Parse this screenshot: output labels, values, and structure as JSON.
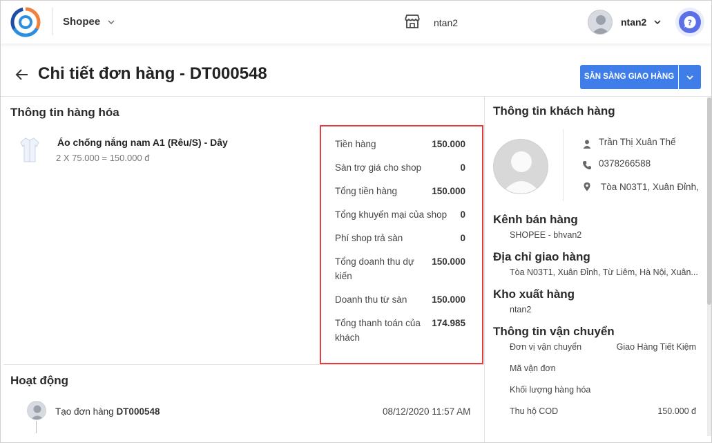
{
  "topbar": {
    "channel": "Shopee",
    "store_name": "ntan2",
    "user_name": "ntan2"
  },
  "header": {
    "title": "Chi tiết đơn hàng - DT000548",
    "ready_button": "SẴN SÀNG GIAO HÀNG"
  },
  "goods": {
    "title": "Thông tin hàng hóa",
    "product_name": "Áo chống nắng nam A1 (Rêu/S) - Dây",
    "product_qty_line": "2 X 75.000 = 150.000 đ"
  },
  "summary": {
    "rows": [
      {
        "label": "Tiền hàng",
        "value": "150.000"
      },
      {
        "label": "Sàn trợ giá cho shop",
        "value": "0"
      },
      {
        "label": "Tổng tiền hàng",
        "value": "150.000"
      },
      {
        "label": "Tổng khuyến mại của shop",
        "value": "0"
      },
      {
        "label": "Phí shop trả sàn",
        "value": "0"
      },
      {
        "label": "Tổng doanh thu dự kiến",
        "value": "150.000"
      },
      {
        "label": "Doanh thu từ sàn",
        "value": "150.000"
      },
      {
        "label": "Tổng thanh toán của khách",
        "value": "174.985"
      }
    ]
  },
  "activity": {
    "title": "Hoạt động",
    "items": [
      {
        "text": "Tạo đơn hàng",
        "code": "DT000548",
        "time": "08/12/2020 11:57 AM"
      }
    ]
  },
  "customer": {
    "title": "Thông tin khách hàng",
    "name": "Trần Thị Xuân Thế",
    "phone": "0378266588",
    "address": "Tòa N03T1, Xuân Đỉnh,"
  },
  "sales_channel": {
    "title": "Kênh bán hàng",
    "value": "SHOPEE - bhvan2"
  },
  "delivery_address": {
    "title": "Địa chỉ giao hàng",
    "value": "Tòa N03T1, Xuân Đỉnh, Từ Liêm, Hà Nội, Xuân..."
  },
  "warehouse": {
    "title": "Kho xuất hàng",
    "value": "ntan2"
  },
  "shipping": {
    "title": "Thông tin vận chuyển",
    "rows": [
      {
        "label": "Đơn vị vận chuyển",
        "value": "Giao Hàng Tiết Kiệm"
      },
      {
        "label": "Mã vận đơn",
        "value": ""
      },
      {
        "label": "Khối lượng hàng hóa",
        "value": ""
      },
      {
        "label": "Thu hộ COD",
        "value": "150.000 đ"
      }
    ]
  },
  "colors": {
    "primary": "#3f7de8",
    "highlight_border": "#e23c3c",
    "help_button": "#5b6fe8"
  },
  "icons": [
    "app-logo-icon",
    "chevron-down-icon",
    "store-icon",
    "help-icon",
    "back-arrow-icon",
    "shirt-icon",
    "person-icon",
    "phone-icon",
    "location-pin-icon"
  ]
}
